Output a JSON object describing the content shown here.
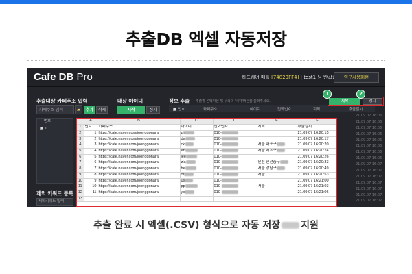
{
  "heading": "추출DB 엑셀 자동저장",
  "caption_before": "추출 완료 시 엑셀(.CSV) 형식으로 자동 저장",
  "caption_after": "지원",
  "app": {
    "logo": "Cafe DB",
    "logo_suffix": "Pro",
    "hw_label": "하드웨어 매틀",
    "hw_code": "[74823FF4]",
    "user": "test1",
    "greeting": "님 반갑습니다!",
    "perm_button": "영구사용패턴",
    "left": {
      "title": "추출대상 카페주소 입력",
      "input_placeholder": "카페주소 입력",
      "add": "추가",
      "delete": "삭제",
      "list_head": "번호",
      "list_row_num": "1"
    },
    "target": {
      "title": "대상 아이디",
      "start": "시작",
      "stop": "정지"
    },
    "info": {
      "title": "정보 추출",
      "hint": "추출할 선택하신 뒤 우측의 '시작'버튼을 눌러주세요.",
      "start": "시작",
      "stop": "정지",
      "columns": [
        "번호",
        "카페주소",
        "아이디",
        "전화번호",
        "지역",
        "추출일시"
      ]
    },
    "exclude": {
      "title": "제외 키워드 등록",
      "input": "제외키워드 입력"
    },
    "callouts": [
      "1",
      "2"
    ],
    "bg_dates": [
      "21.09.07 16:06",
      "21.09.07 16:06",
      "21.09.07 16:06",
      "21.09.07 16:06",
      "21.09.07 16:06",
      "21.09.07 16:06",
      "21.09.07 16:06",
      "21.09.07 16:06",
      "21.09.07 16:07",
      "21.09.07 16:07",
      "21.09.07 16:07",
      "21.09.07 16:07",
      "21.09.07 16:07",
      "21.09.07 16:07",
      "21.09.07 16:07"
    ]
  },
  "sheet": {
    "col_letters": [
      "A",
      "B",
      "C",
      "D",
      "E",
      "F"
    ],
    "headers": [
      "번호",
      "카페주소",
      "아이디",
      "전화번호",
      "지역",
      "추출일시"
    ],
    "rows": [
      {
        "num": "1",
        "url": "https://cafe.naver.com/joonggonara",
        "id": "zli",
        "phone": "010-",
        "region": "",
        "date": "21.09.07 16:20:15"
      },
      {
        "num": "2",
        "url": "https://cafe.naver.com/joonggonara",
        "id": "da",
        "phone": "010-",
        "region": "",
        "date": "21.09.07 16:20:17"
      },
      {
        "num": "3",
        "url": "https://cafe.naver.com/joonggonara",
        "id": "cki",
        "phone": "010-",
        "region": "서울 마포구",
        "date": "21.09.07 16:20:20"
      },
      {
        "num": "4",
        "url": "https://cafe.naver.com/joonggonara",
        "id": "en",
        "phone": "010-",
        "region": "서울 서초구",
        "date": "21.09.07 16:20:24"
      },
      {
        "num": "5",
        "url": "https://cafe.naver.com/joonggonara",
        "id": "lee",
        "phone": "010-",
        "region": "",
        "date": "21.09.07 16:20:26"
      },
      {
        "num": "6",
        "url": "https://cafe.naver.com/joonggonara",
        "id": "zla",
        "phone": "010-",
        "region": "인천 인천중구",
        "date": "21.09.07 16:20:33"
      },
      {
        "num": "7",
        "url": "https://cafe.naver.com/joonggonara",
        "id": "he",
        "phone": "010-",
        "region": "서울 강남구",
        "date": "21.09.07 16:20:49"
      },
      {
        "num": "8",
        "url": "https://cafe.naver.com/joonggonara",
        "id": "of",
        "phone": "010-",
        "region": "서울",
        "date": "21.09.07 16:20:53"
      },
      {
        "num": "9",
        "url": "https://cafe.naver.com/joonggonara",
        "id": "us",
        "phone": "010-",
        "region": "",
        "date": "21.09.07 16:21:00"
      },
      {
        "num": "10",
        "url": "https://cafe.naver.com/joonggonara",
        "id": "pp",
        "phone": "010-",
        "region": "서울",
        "date": "21.09.07 16:21:03"
      },
      {
        "num": "11",
        "url": "https://cafe.naver.com/joonggonara",
        "id": "yo",
        "phone": "010-",
        "region": "",
        "date": "21.09.07 16:21:06"
      }
    ],
    "row_numbers": [
      "1",
      "2",
      "3",
      "4",
      "5",
      "6",
      "7",
      "8",
      "9",
      "10",
      "11",
      "12",
      "13"
    ]
  }
}
